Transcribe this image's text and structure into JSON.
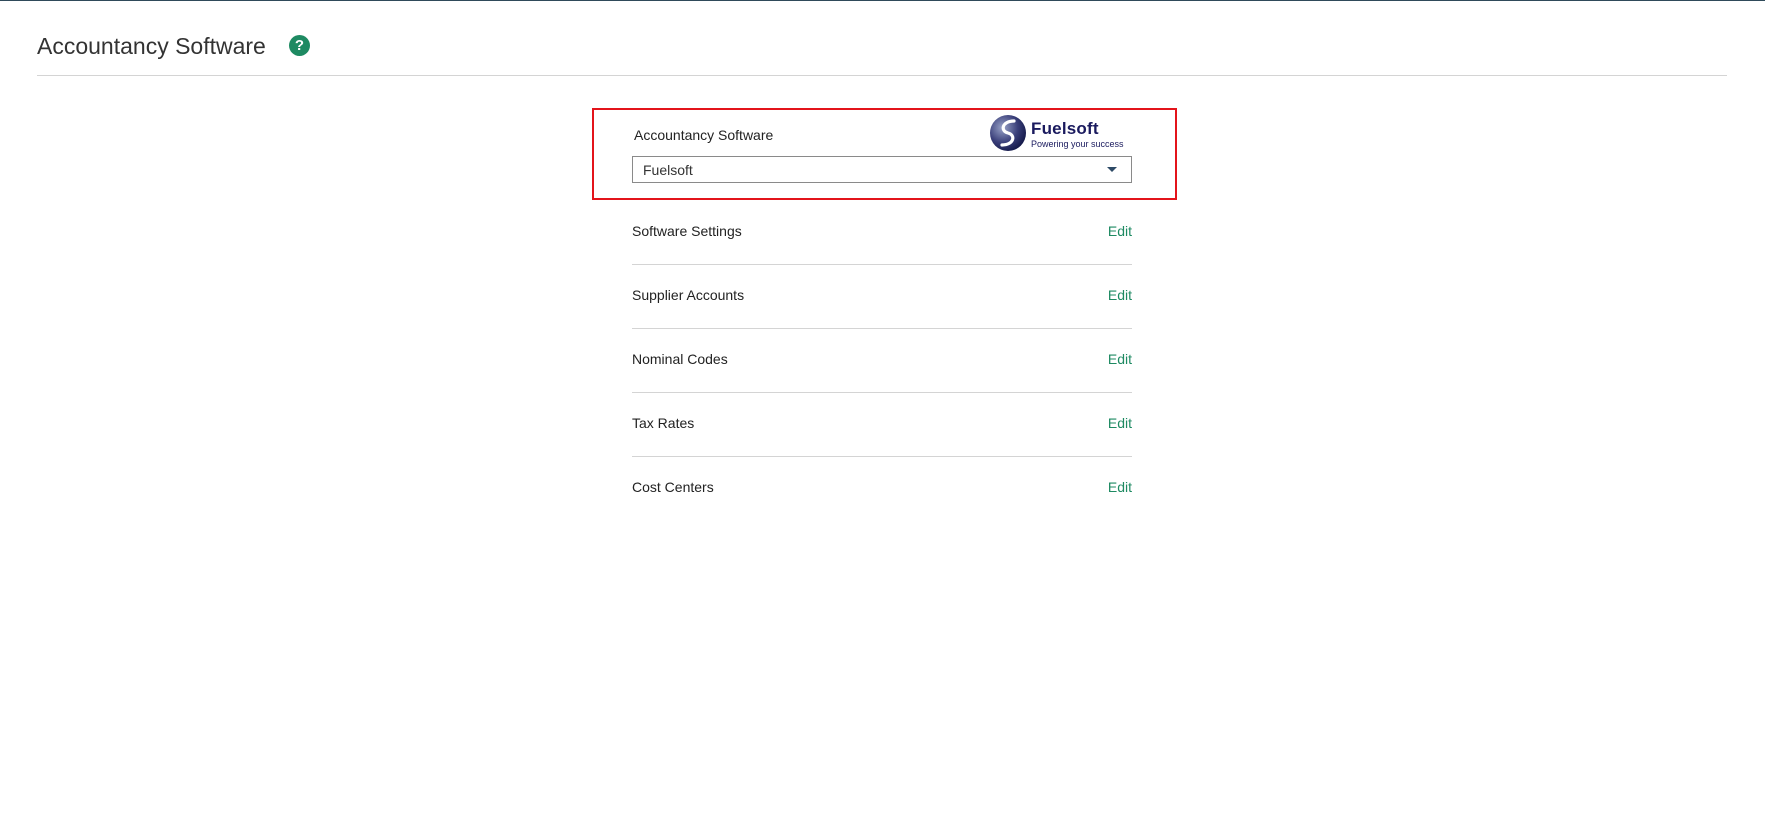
{
  "page": {
    "title": "Accountancy Software",
    "help_icon": "?"
  },
  "software": {
    "label": "Accountancy Software",
    "selected": "Fuelsoft",
    "logo": {
      "name": "Fuelsoft",
      "tagline": "Powering your success"
    }
  },
  "settings": [
    {
      "label": "Software Settings",
      "action": "Edit"
    },
    {
      "label": "Supplier Accounts",
      "action": "Edit"
    },
    {
      "label": "Nominal Codes",
      "action": "Edit"
    },
    {
      "label": "Tax Rates",
      "action": "Edit"
    },
    {
      "label": "Cost Centers",
      "action": "Edit"
    }
  ],
  "colors": {
    "accent": "#1e8a62",
    "highlight_border": "#e3141b",
    "logo_navy": "#1a1a5e"
  }
}
